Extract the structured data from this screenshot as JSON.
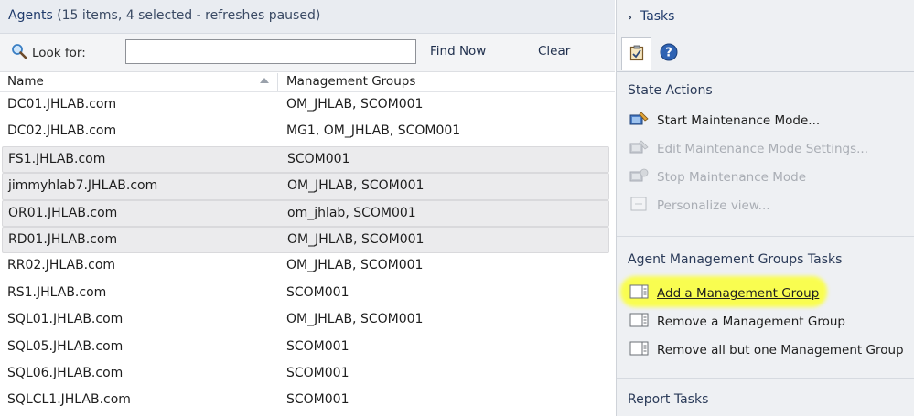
{
  "header": {
    "title": "Agents",
    "subtitle": "(15 items, 4 selected - refreshes paused)"
  },
  "search": {
    "look_for_label": "Look for:",
    "value": "",
    "placeholder": "",
    "find_now_label": "Find Now",
    "clear_label": "Clear"
  },
  "grid": {
    "columns": [
      "Name",
      "Management Groups"
    ],
    "sort_column": "Name",
    "sort_direction": "ascending",
    "rows": [
      {
        "name": "DC01.JHLAB.com",
        "mg": "OM_JHLAB, SCOM001",
        "selected": false
      },
      {
        "name": "DC02.JHLAB.com",
        "mg": "MG1, OM_JHLAB, SCOM001",
        "selected": false
      },
      {
        "name": "FS1.JHLAB.com",
        "mg": "SCOM001",
        "selected": true
      },
      {
        "name": "jimmyhlab7.JHLAB.com",
        "mg": "OM_JHLAB, SCOM001",
        "selected": true
      },
      {
        "name": "OR01.JHLAB.com",
        "mg": "om_jhlab, SCOM001",
        "selected": true
      },
      {
        "name": "RD01.JHLAB.com",
        "mg": "OM_JHLAB, SCOM001",
        "selected": true
      },
      {
        "name": "RR02.JHLAB.com",
        "mg": "OM_JHLAB, SCOM001",
        "selected": false
      },
      {
        "name": "RS1.JHLAB.com",
        "mg": "SCOM001",
        "selected": false
      },
      {
        "name": "SQL01.JHLAB.com",
        "mg": "OM_JHLAB, SCOM001",
        "selected": false
      },
      {
        "name": "SQL05.JHLAB.com",
        "mg": "SCOM001",
        "selected": false
      },
      {
        "name": "SQL06.JHLAB.com",
        "mg": "SCOM001",
        "selected": false
      },
      {
        "name": "SQLCL1.JHLAB.com",
        "mg": "SCOM001",
        "selected": false
      }
    ]
  },
  "tasks": {
    "title": "Tasks",
    "tabs": [
      {
        "icon": "tasks-clipboard-icon",
        "active": true
      },
      {
        "icon": "help-icon",
        "active": false
      }
    ],
    "state_actions": {
      "title": "State Actions",
      "items": [
        {
          "label": "Start Maintenance Mode...",
          "enabled": true,
          "icon": "maintenance-mode-icon"
        },
        {
          "label": "Edit Maintenance Mode Settings...",
          "enabled": false,
          "icon": "maintenance-settings-icon"
        },
        {
          "label": "Stop Maintenance Mode",
          "enabled": false,
          "icon": "stop-maintenance-icon"
        },
        {
          "label": "Personalize view...",
          "enabled": false,
          "icon": "personalize-view-icon"
        }
      ]
    },
    "agent_mg_tasks": {
      "title": "Agent Management Groups Tasks",
      "items": [
        {
          "label": "Add a Management Group",
          "enabled": true,
          "highlighted": true,
          "icon": "task-window-icon"
        },
        {
          "label": "Remove a Management Group",
          "enabled": true,
          "icon": "task-window-icon"
        },
        {
          "label": "Remove all but one Management Group",
          "enabled": true,
          "icon": "task-window-icon"
        }
      ]
    },
    "report_tasks": {
      "title": "Report Tasks"
    }
  },
  "colors": {
    "header_bg": "#e9ecf1",
    "tasks_pane_bg": "#eef0f3",
    "selected_row_bg": "#ebebed",
    "highlight": "#fbff3f",
    "section_title": "#2a3a58"
  }
}
